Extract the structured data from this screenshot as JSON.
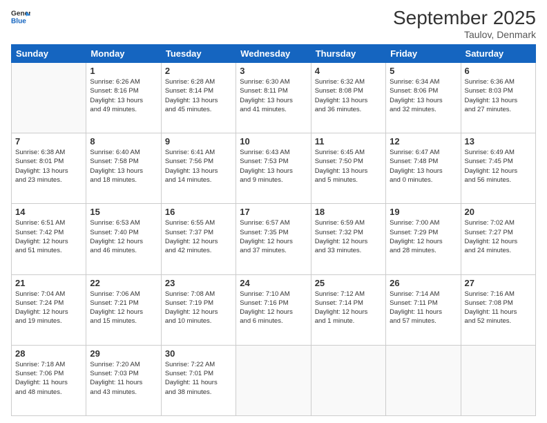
{
  "header": {
    "logo_line1": "General",
    "logo_line2": "Blue",
    "title": "September 2025",
    "subtitle": "Taulov, Denmark"
  },
  "days_of_week": [
    "Sunday",
    "Monday",
    "Tuesday",
    "Wednesday",
    "Thursday",
    "Friday",
    "Saturday"
  ],
  "weeks": [
    [
      {
        "day": "",
        "info": ""
      },
      {
        "day": "1",
        "info": "Sunrise: 6:26 AM\nSunset: 8:16 PM\nDaylight: 13 hours\nand 49 minutes."
      },
      {
        "day": "2",
        "info": "Sunrise: 6:28 AM\nSunset: 8:14 PM\nDaylight: 13 hours\nand 45 minutes."
      },
      {
        "day": "3",
        "info": "Sunrise: 6:30 AM\nSunset: 8:11 PM\nDaylight: 13 hours\nand 41 minutes."
      },
      {
        "day": "4",
        "info": "Sunrise: 6:32 AM\nSunset: 8:08 PM\nDaylight: 13 hours\nand 36 minutes."
      },
      {
        "day": "5",
        "info": "Sunrise: 6:34 AM\nSunset: 8:06 PM\nDaylight: 13 hours\nand 32 minutes."
      },
      {
        "day": "6",
        "info": "Sunrise: 6:36 AM\nSunset: 8:03 PM\nDaylight: 13 hours\nand 27 minutes."
      }
    ],
    [
      {
        "day": "7",
        "info": "Sunrise: 6:38 AM\nSunset: 8:01 PM\nDaylight: 13 hours\nand 23 minutes."
      },
      {
        "day": "8",
        "info": "Sunrise: 6:40 AM\nSunset: 7:58 PM\nDaylight: 13 hours\nand 18 minutes."
      },
      {
        "day": "9",
        "info": "Sunrise: 6:41 AM\nSunset: 7:56 PM\nDaylight: 13 hours\nand 14 minutes."
      },
      {
        "day": "10",
        "info": "Sunrise: 6:43 AM\nSunset: 7:53 PM\nDaylight: 13 hours\nand 9 minutes."
      },
      {
        "day": "11",
        "info": "Sunrise: 6:45 AM\nSunset: 7:50 PM\nDaylight: 13 hours\nand 5 minutes."
      },
      {
        "day": "12",
        "info": "Sunrise: 6:47 AM\nSunset: 7:48 PM\nDaylight: 13 hours\nand 0 minutes."
      },
      {
        "day": "13",
        "info": "Sunrise: 6:49 AM\nSunset: 7:45 PM\nDaylight: 12 hours\nand 56 minutes."
      }
    ],
    [
      {
        "day": "14",
        "info": "Sunrise: 6:51 AM\nSunset: 7:42 PM\nDaylight: 12 hours\nand 51 minutes."
      },
      {
        "day": "15",
        "info": "Sunrise: 6:53 AM\nSunset: 7:40 PM\nDaylight: 12 hours\nand 46 minutes."
      },
      {
        "day": "16",
        "info": "Sunrise: 6:55 AM\nSunset: 7:37 PM\nDaylight: 12 hours\nand 42 minutes."
      },
      {
        "day": "17",
        "info": "Sunrise: 6:57 AM\nSunset: 7:35 PM\nDaylight: 12 hours\nand 37 minutes."
      },
      {
        "day": "18",
        "info": "Sunrise: 6:59 AM\nSunset: 7:32 PM\nDaylight: 12 hours\nand 33 minutes."
      },
      {
        "day": "19",
        "info": "Sunrise: 7:00 AM\nSunset: 7:29 PM\nDaylight: 12 hours\nand 28 minutes."
      },
      {
        "day": "20",
        "info": "Sunrise: 7:02 AM\nSunset: 7:27 PM\nDaylight: 12 hours\nand 24 minutes."
      }
    ],
    [
      {
        "day": "21",
        "info": "Sunrise: 7:04 AM\nSunset: 7:24 PM\nDaylight: 12 hours\nand 19 minutes."
      },
      {
        "day": "22",
        "info": "Sunrise: 7:06 AM\nSunset: 7:21 PM\nDaylight: 12 hours\nand 15 minutes."
      },
      {
        "day": "23",
        "info": "Sunrise: 7:08 AM\nSunset: 7:19 PM\nDaylight: 12 hours\nand 10 minutes."
      },
      {
        "day": "24",
        "info": "Sunrise: 7:10 AM\nSunset: 7:16 PM\nDaylight: 12 hours\nand 6 minutes."
      },
      {
        "day": "25",
        "info": "Sunrise: 7:12 AM\nSunset: 7:14 PM\nDaylight: 12 hours\nand 1 minute."
      },
      {
        "day": "26",
        "info": "Sunrise: 7:14 AM\nSunset: 7:11 PM\nDaylight: 11 hours\nand 57 minutes."
      },
      {
        "day": "27",
        "info": "Sunrise: 7:16 AM\nSunset: 7:08 PM\nDaylight: 11 hours\nand 52 minutes."
      }
    ],
    [
      {
        "day": "28",
        "info": "Sunrise: 7:18 AM\nSunset: 7:06 PM\nDaylight: 11 hours\nand 48 minutes."
      },
      {
        "day": "29",
        "info": "Sunrise: 7:20 AM\nSunset: 7:03 PM\nDaylight: 11 hours\nand 43 minutes."
      },
      {
        "day": "30",
        "info": "Sunrise: 7:22 AM\nSunset: 7:01 PM\nDaylight: 11 hours\nand 38 minutes."
      },
      {
        "day": "",
        "info": ""
      },
      {
        "day": "",
        "info": ""
      },
      {
        "day": "",
        "info": ""
      },
      {
        "day": "",
        "info": ""
      }
    ]
  ]
}
